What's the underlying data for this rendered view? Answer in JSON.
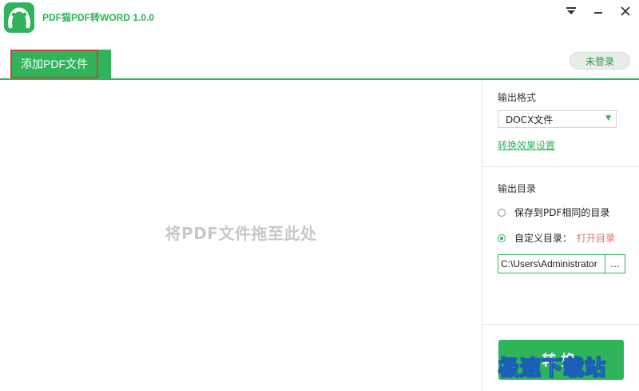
{
  "window": {
    "title": "PDF猫PDF转WORD 1.0.0",
    "controls": [
      "menu",
      "minimize",
      "close"
    ]
  },
  "toolbar": {
    "add_file_label": "添加PDF文件",
    "login_label": "未登录"
  },
  "dropzone": {
    "hint": "将PDF文件拖至此处"
  },
  "sidebar": {
    "output_format": {
      "title": "输出格式",
      "selected": "DOCX文件",
      "settings_link": "转换效果设置"
    },
    "output_dir": {
      "title": "输出目录",
      "options": [
        {
          "label": "保存到PDF相同的目录",
          "checked": false
        },
        {
          "label": "自定义目录：",
          "checked": true
        }
      ],
      "open_dir_label": "打开目录",
      "path_value": "C:\\Users\\Administrator",
      "browse_label": "..."
    },
    "convert_label": "转换"
  },
  "watermark": "极速下载站",
  "colors": {
    "accent": "#2fb45a",
    "tab_highlight_border": "#c9463c",
    "open_dir_text": "#e07070",
    "watermark_outline": "#1c5fb6"
  }
}
